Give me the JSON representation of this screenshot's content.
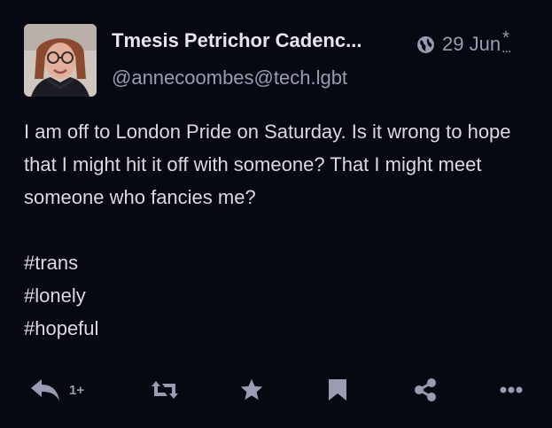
{
  "author": {
    "display_name": "Tmesis Petrichor Cadenc...",
    "handle": "@annecoombes@tech.lgbt",
    "avatar": "profile-photo"
  },
  "meta": {
    "visibility_icon": "globe-icon",
    "date": "29 Jun",
    "edited_mark": "*",
    "edited_dots": "..."
  },
  "post": {
    "text": "I am off to London Pride on Saturday. Is it wrong to hope that I might hit it off with someone? That I might meet someone who fancies me?",
    "hashtags": [
      "#trans",
      "#lonely",
      "#hopeful"
    ]
  },
  "actions": {
    "reply_count": "1+",
    "icons": [
      "reply-icon",
      "boost-icon",
      "favourite-icon",
      "bookmark-icon",
      "share-icon",
      "more-icon"
    ]
  },
  "colors": {
    "background": "#060812",
    "text": "#d9dae3",
    "muted": "#9a9cb1"
  }
}
